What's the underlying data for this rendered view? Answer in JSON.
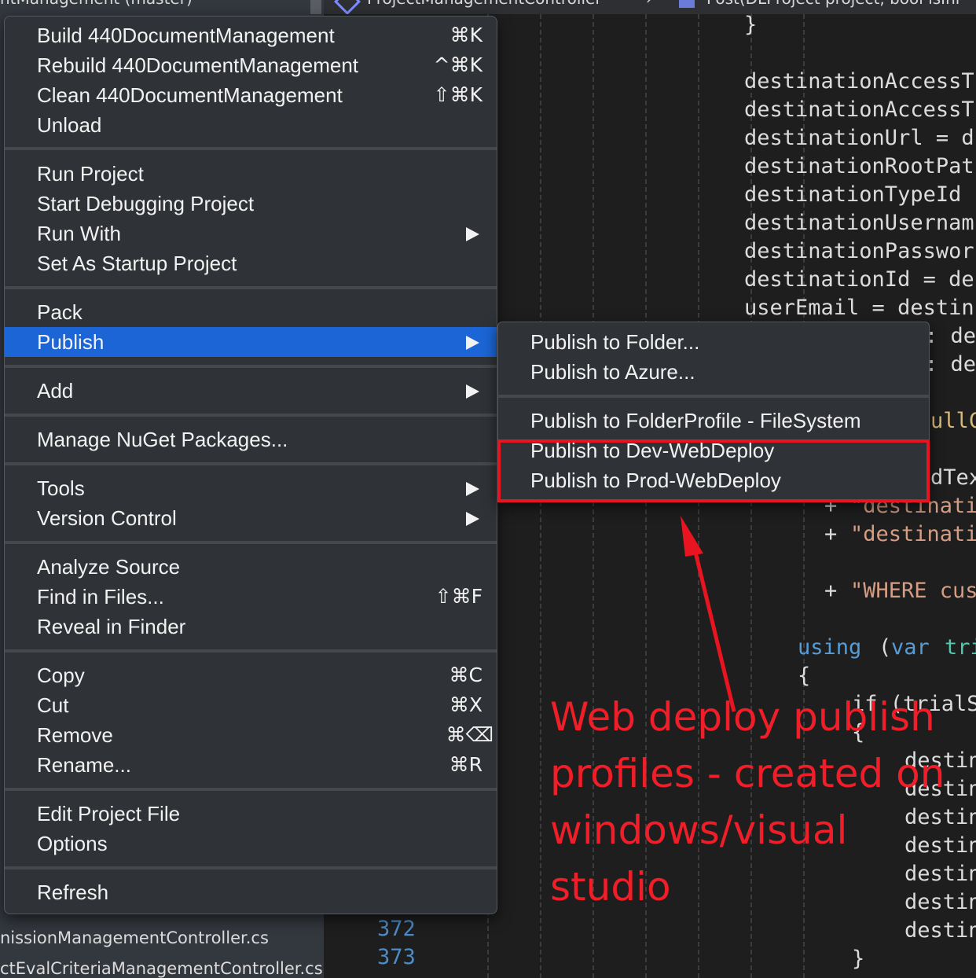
{
  "solution_pad": {
    "title": "ntManagement (master)",
    "files": [
      "nissionManagementController.cs",
      "ctEvalCriteriaManagementController.cs"
    ]
  },
  "tabs": [
    {
      "label": "ProjectManagementController"
    },
    {
      "label": "Post(DLProject project, bool isIni"
    }
  ],
  "editor": {
    "line_numbers": [
      "372",
      "373"
    ],
    "code": {
      "l0": "}",
      "l1": "destinationAccessT",
      "l2": "destinationAccessT",
      "l3": "destinationUrl = d",
      "l4": "destinationRootPat",
      "l5": "destinationTypeId",
      "l6": "destinationUsernam",
      "l7": "destinationPasswor",
      "l8": "destinationId = de",
      "l9": "userEmail = destin",
      "l10a": ": des",
      "l10b": ": des",
      "l11": "ullC",
      "l12": "dTex",
      "l13_plus": "+",
      "l13_str": "\"destinati",
      "l14_plus": "+",
      "l14_str": "\"destinati",
      "l15_plus": "+",
      "l15_str": "\"WHERE cus",
      "l16_kw": "using",
      "l16_rest": "(",
      "l16_var": "var",
      "l16_tri": "tri",
      "l17": "{",
      "l18": "if (trialS",
      "l19": "{",
      "l20": "destin",
      "l21": "destin",
      "l22": "destin",
      "l23": "destin",
      "l24": "destin",
      "l25": "destin",
      "l26": "destin",
      "l27": "}"
    }
  },
  "context_menu": {
    "groups": [
      [
        {
          "label": "Build 440DocumentManagement",
          "shortcut": "⌘K"
        },
        {
          "label": "Rebuild 440DocumentManagement",
          "shortcut": "^⌘K"
        },
        {
          "label": "Clean 440DocumentManagement",
          "shortcut": "⇧⌘K"
        },
        {
          "label": "Unload",
          "shortcut": ""
        }
      ],
      [
        {
          "label": "Run Project",
          "shortcut": ""
        },
        {
          "label": "Start Debugging Project",
          "shortcut": ""
        },
        {
          "label": "Run With",
          "shortcut": ""
        },
        {
          "label": "Set As Startup Project",
          "shortcut": ""
        }
      ],
      [
        {
          "label": "Pack",
          "shortcut": ""
        },
        {
          "label": "Publish",
          "shortcut": ""
        }
      ],
      [
        {
          "label": "Add",
          "shortcut": ""
        }
      ],
      [
        {
          "label": "Manage NuGet Packages...",
          "shortcut": ""
        }
      ],
      [
        {
          "label": "Tools",
          "shortcut": ""
        },
        {
          "label": "Version Control",
          "shortcut": ""
        }
      ],
      [
        {
          "label": "Analyze Source",
          "shortcut": ""
        },
        {
          "label": "Find in Files...",
          "shortcut": "⇧⌘F"
        },
        {
          "label": "Reveal in Finder",
          "shortcut": ""
        }
      ],
      [
        {
          "label": "Copy",
          "shortcut": "⌘C"
        },
        {
          "label": "Cut",
          "shortcut": "⌘X"
        },
        {
          "label": "Remove",
          "shortcut": "⌘⌫"
        },
        {
          "label": "Rename...",
          "shortcut": "⌘R"
        }
      ],
      [
        {
          "label": "Edit Project File",
          "shortcut": ""
        },
        {
          "label": "Options",
          "shortcut": ""
        }
      ],
      [
        {
          "label": "Refresh",
          "shortcut": ""
        }
      ]
    ]
  },
  "submenu": {
    "groups": [
      [
        {
          "label": "Publish to Folder..."
        },
        {
          "label": "Publish to Azure..."
        }
      ],
      [
        {
          "label": "Publish to FolderProfile - FileSystem"
        },
        {
          "label": "Publish to Dev-WebDeploy"
        },
        {
          "label": "Publish to Prod-WebDeploy"
        }
      ]
    ]
  },
  "annotation": {
    "text": "Web deploy publish profiles - created on windows/visual studio",
    "color": "#f01e28"
  },
  "colors": {
    "menu_bg": "#2f3236",
    "highlight": "#1c65d6",
    "editor_bg": "#1e1e1e"
  }
}
